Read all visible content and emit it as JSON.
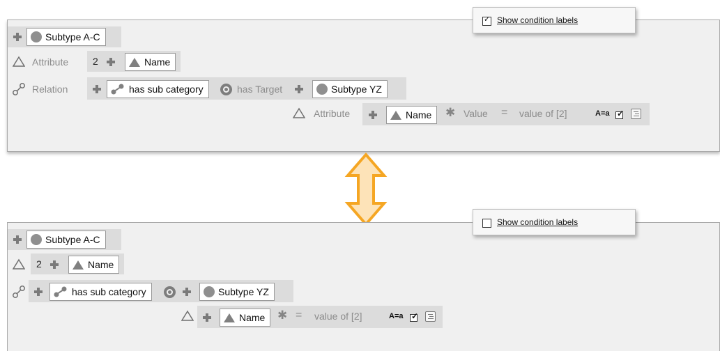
{
  "top": {
    "option": {
      "label": "Show condition labels",
      "checked": true
    },
    "root": {
      "plus_icon": "plus-icon",
      "circle_icon": "circle-icon",
      "label": "Subtype A-C"
    },
    "attribute_row": {
      "icon": "triangle-outline-icon",
      "label": "Attribute",
      "number": "2",
      "field_icon": "triangle-icon",
      "field": "Name"
    },
    "relation_row": {
      "icon": "relation-icon",
      "label": "Relation",
      "relation": "has sub category",
      "target_icon": "target-icon",
      "target_label": "has Target",
      "target": "Subtype YZ"
    },
    "inner_attribute_row": {
      "label": "Attribute",
      "field": "Name",
      "value_label": "Value",
      "equals": "=",
      "value": "value of [2]",
      "case_label": "A=a",
      "case_checked": true
    }
  },
  "arrow": {
    "icon": "double-arrow-icon",
    "color": "#f5a623",
    "fill": "#fde3b8"
  },
  "bottom": {
    "option": {
      "label": "Show condition labels",
      "checked": false
    },
    "root": {
      "label": "Subtype A-C"
    },
    "attribute_row": {
      "number": "2",
      "field": "Name"
    },
    "relation_row": {
      "relation": "has sub category",
      "target": "Subtype YZ"
    },
    "inner_attribute_row": {
      "field": "Name",
      "equals": "=",
      "value": "value of [2]",
      "case_label": "A=a",
      "case_checked": true
    }
  }
}
